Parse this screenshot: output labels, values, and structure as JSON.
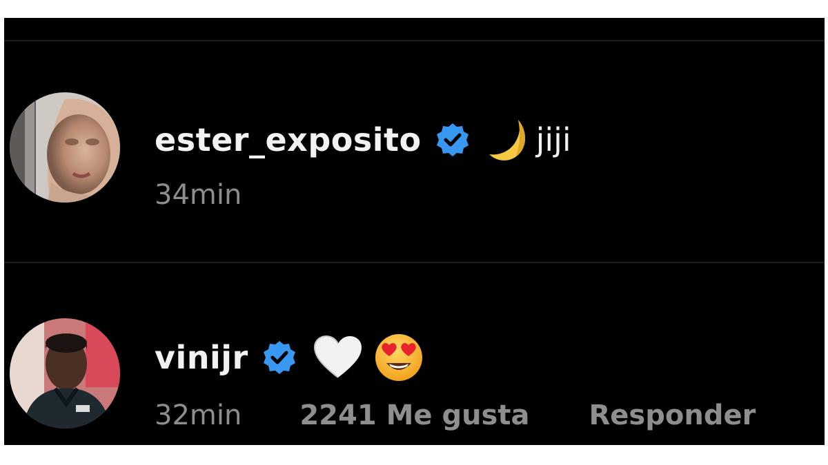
{
  "comments": [
    {
      "username": "ester_exposito",
      "verified": true,
      "emoji_1": "moon-icon",
      "text": "jiji",
      "time": "34min"
    },
    {
      "username": "vinijr",
      "verified": true,
      "emoji_1": "white-heart-icon",
      "emoji_2": "heart-eyes-icon",
      "text": "",
      "time": "32min",
      "likes": "2241 Me gusta",
      "reply": "Responder"
    }
  ],
  "colors": {
    "background": "#000000",
    "username": "#f2f2f2",
    "meta": "#8e8e8e",
    "verified_badge": "#3897f0"
  }
}
